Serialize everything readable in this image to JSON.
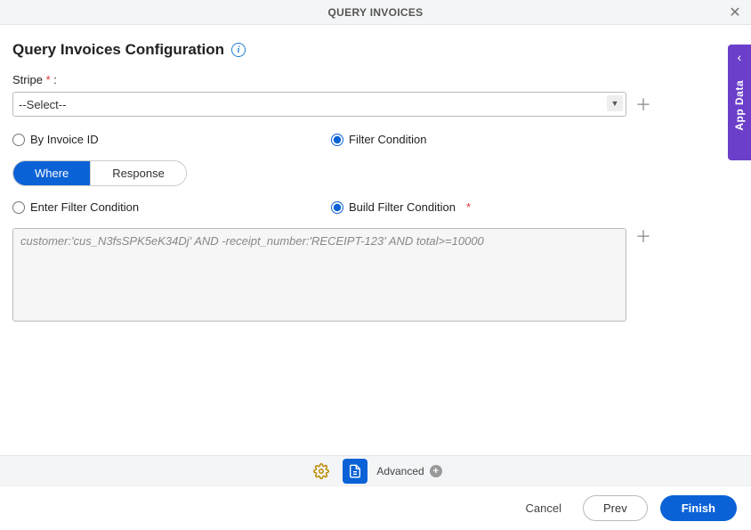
{
  "header": {
    "title": "QUERY INVOICES"
  },
  "page": {
    "title": "Query Invoices Configuration",
    "info_tooltip": "i"
  },
  "stripe": {
    "label": "Stripe",
    "required_marker": "*",
    "colon": ":",
    "select_value": "--Select--"
  },
  "mode": {
    "by_invoice_id": {
      "label": "By Invoice ID",
      "checked": false
    },
    "filter_condition": {
      "label": "Filter Condition",
      "checked": true
    }
  },
  "tabs": {
    "where": "Where",
    "response": "Response",
    "active": "where"
  },
  "filter_mode": {
    "enter": {
      "label": "Enter Filter Condition",
      "checked": false
    },
    "build": {
      "label": "Build Filter Condition",
      "required_marker": "*",
      "checked": true
    }
  },
  "filter_textarea": {
    "value": "customer:'cus_N3fsSPK5eK34Dj' AND -receipt_number:'RECEIPT-123' AND total>=10000"
  },
  "side_tab": {
    "label": "App Data"
  },
  "toolbar": {
    "advanced_label": "Advanced"
  },
  "footer": {
    "cancel": "Cancel",
    "prev": "Prev",
    "finish": "Finish"
  }
}
